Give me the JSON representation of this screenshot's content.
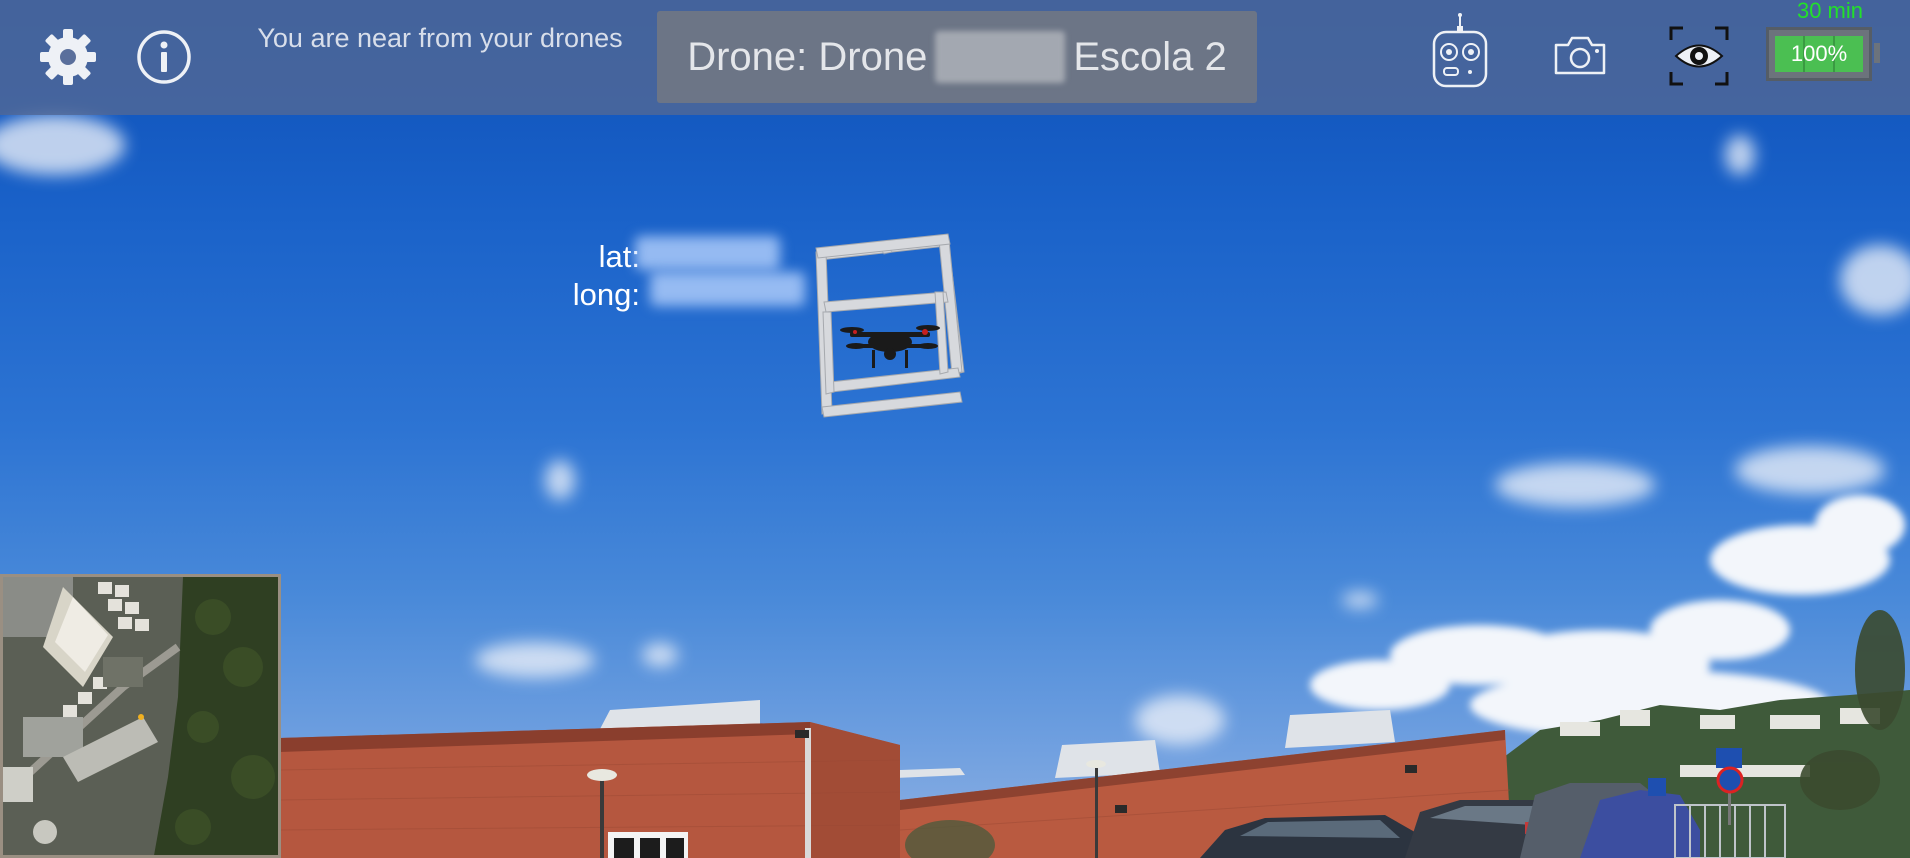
{
  "topbar": {
    "status_text": "You are near from your drones",
    "drone_title_prefix": "Drone: Drone",
    "drone_title_suffix": "Escola 2",
    "flight_time": "30 min",
    "battery_level": "100%"
  },
  "telemetry": {
    "lat_label": "lat:",
    "long_label": "long:"
  },
  "icons": {
    "settings": "gear-icon",
    "info": "info-icon",
    "controller": "remote-controller-icon",
    "camera": "camera-icon",
    "view": "eye-focus-icon"
  },
  "colors": {
    "topbar": "#50689a",
    "timer": "#22e02a",
    "battery_fill": "#4bbf52"
  }
}
